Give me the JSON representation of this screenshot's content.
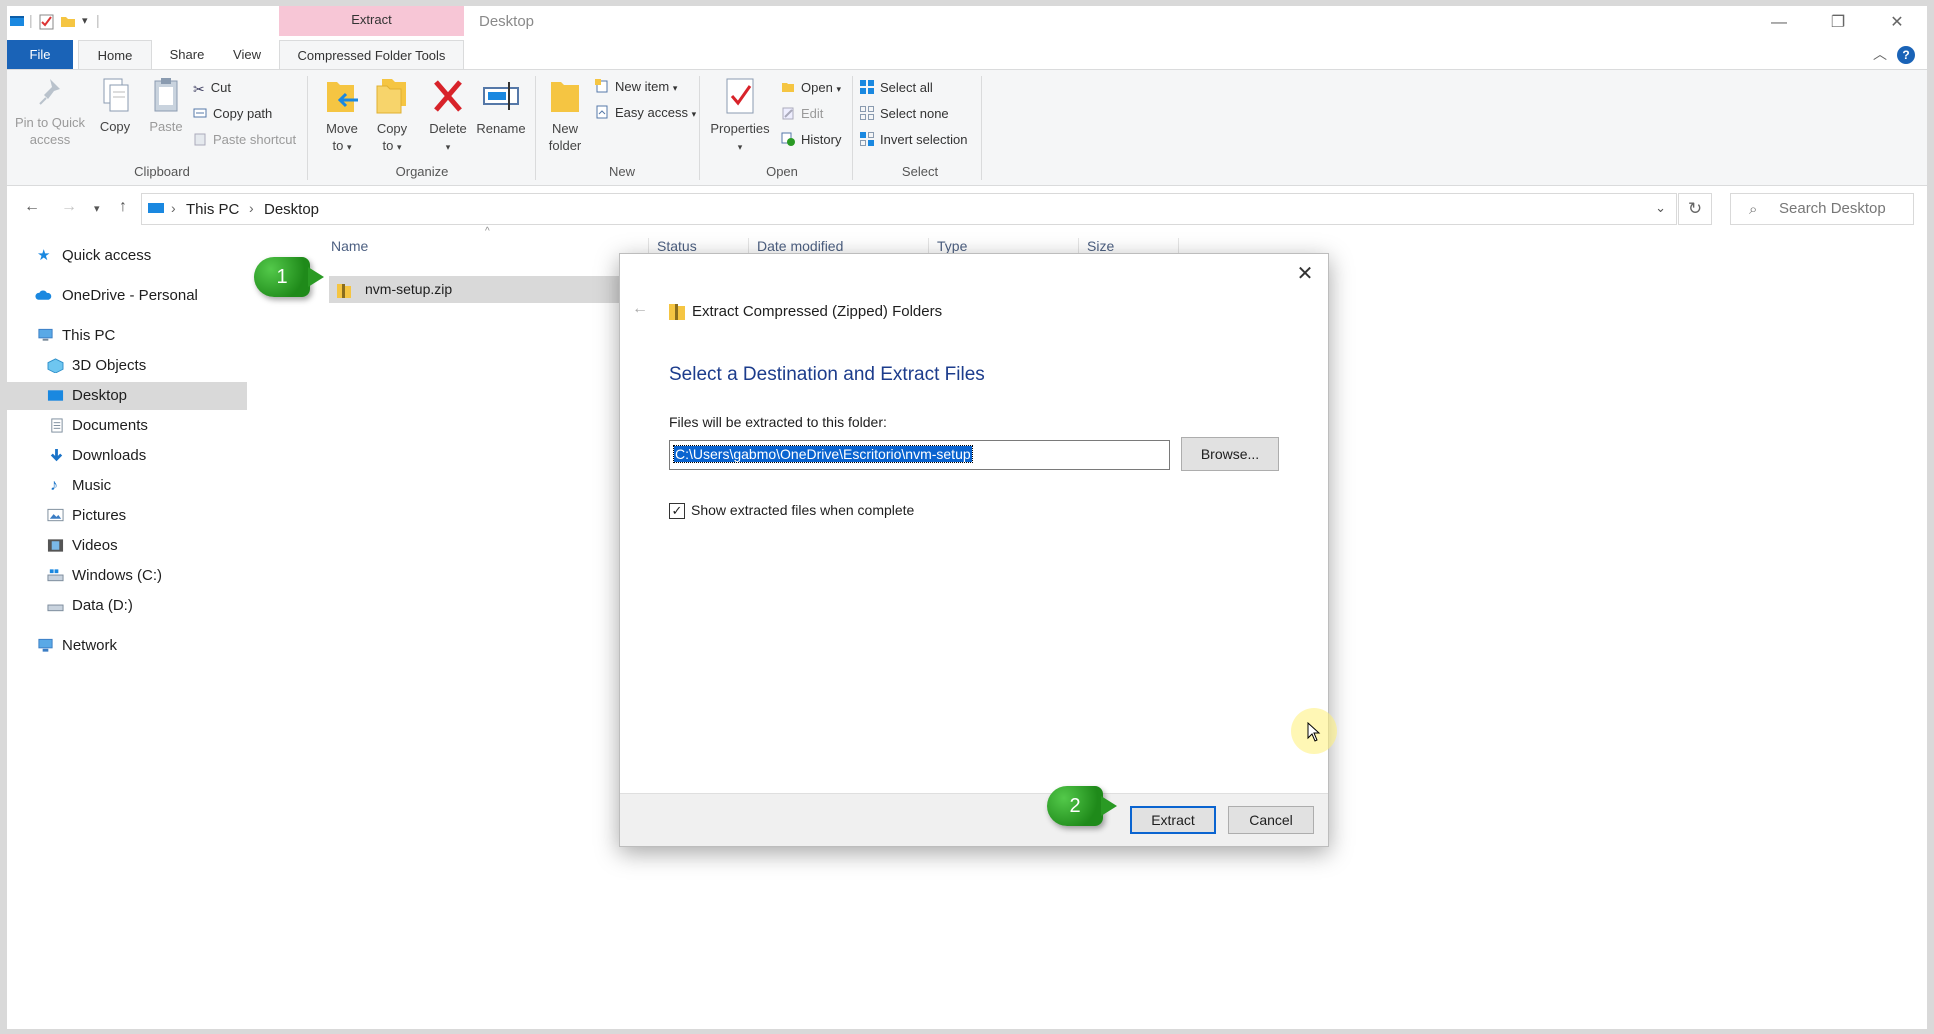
{
  "title_bar": {
    "contextual_tab_header": "Extract",
    "window_title": "Desktop"
  },
  "ribbon_tabs": [
    "File",
    "Home",
    "Share",
    "View",
    "Compressed Folder Tools"
  ],
  "ribbon": {
    "clipboard": {
      "pin_label_1": "Pin to Quick",
      "pin_label_2": "access",
      "copy": "Copy",
      "paste": "Paste",
      "cut": "Cut",
      "copy_path": "Copy path",
      "paste_shortcut": "Paste shortcut",
      "group": "Clipboard"
    },
    "organize": {
      "move_to_1": "Move",
      "move_to_2": "to",
      "copy_to_1": "Copy",
      "copy_to_2": "to",
      "delete": "Delete",
      "rename": "Rename",
      "group": "Organize"
    },
    "new": {
      "new_folder_1": "New",
      "new_folder_2": "folder",
      "new_item": "New item",
      "easy_access": "Easy access",
      "group": "New"
    },
    "open": {
      "properties": "Properties",
      "open": "Open",
      "edit": "Edit",
      "history": "History",
      "group": "Open"
    },
    "select": {
      "select_all": "Select all",
      "select_none": "Select none",
      "invert_selection": "Invert selection",
      "group": "Select"
    }
  },
  "address": {
    "crumb_1": "This PC",
    "crumb_2": "Desktop",
    "search_placeholder": "Search Desktop"
  },
  "nav_pane": {
    "quick_access": "Quick access",
    "onedrive": "OneDrive - Personal",
    "this_pc": "This PC",
    "objects_3d": "3D Objects",
    "desktop": "Desktop",
    "documents": "Documents",
    "downloads": "Downloads",
    "music": "Music",
    "pictures": "Pictures",
    "videos": "Videos",
    "windows_c": "Windows (C:)",
    "data_d": "Data (D:)",
    "network": "Network"
  },
  "file_list": {
    "columns": [
      "Name",
      "Status",
      "Date modified",
      "Type",
      "Size"
    ],
    "rows": [
      {
        "name": "nvm-setup.zip"
      }
    ]
  },
  "dialog": {
    "title": "Extract Compressed (Zipped) Folders",
    "heading": "Select a Destination and Extract Files",
    "folder_label": "Files will be extracted to this folder:",
    "folder_path": "C:\\Users\\gabmo\\OneDrive\\Escritorio\\nvm-setup",
    "browse": "Browse...",
    "show_files_label": "Show extracted files when complete",
    "show_files_checked": true,
    "extract": "Extract",
    "cancel": "Cancel"
  },
  "annotations": {
    "step_1": "1",
    "step_2": "2"
  },
  "colors": {
    "file_tab": "#1a63b7",
    "contextual_tab": "#f7c6d6",
    "dialog_heading": "#1c3c8c",
    "selection": "#0a64d0",
    "step_badge": "#2a9a24"
  }
}
